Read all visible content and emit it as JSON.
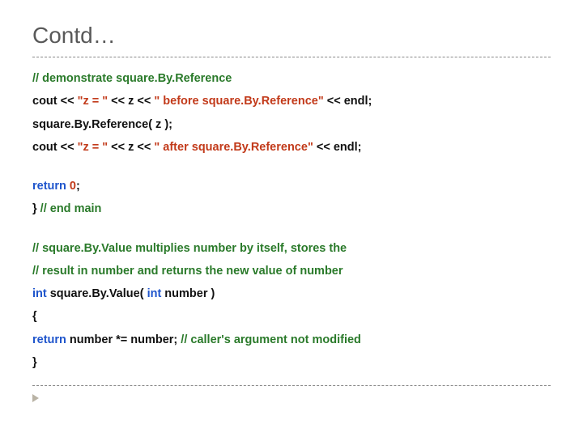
{
  "title": "Contd…",
  "l1": " // demonstrate square.By.Reference",
  "l2a": "cout << ",
  "l2b": "\"z = \" ",
  "l2c": "<< z << ",
  "l2d": "\" before square.By.Reference\"",
  "l2e": " << endl;",
  "l3": "square.By.Reference( z );",
  "l4a": "cout << ",
  "l4b": "\"z = \" ",
  "l4c": "<< z << ",
  "l4d": "\" after square.By.Reference\"",
  "l4e": " << endl;",
  "l5a": "return ",
  "l5b": "0",
  "l5c": ";",
  "l6a": "} ",
  "l6b": "// end main",
  "l7": "// square.By.Value multiplies number by itself, stores the",
  "l8": "// result in number and returns the new value of number",
  "l9a": "int",
  "l9b": " square.By.Value( ",
  "l9c": "int",
  "l9d": " number )",
  "l10": "   {",
  "l11a": "return ",
  "l11b": "number *= number;  ",
  "l11c": "// caller's argument not modified",
  "l12": "}"
}
